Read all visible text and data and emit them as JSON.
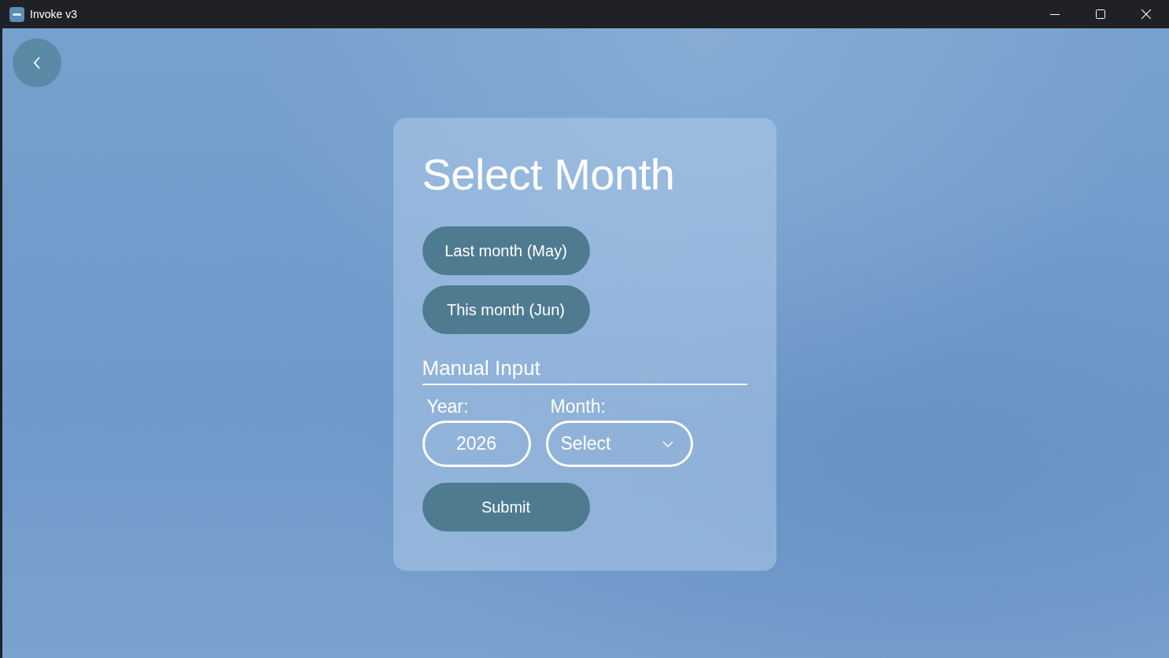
{
  "window": {
    "title": "Invoke v3"
  },
  "heading": "Select Month",
  "quick_buttons": [
    {
      "label": "Last month (May)"
    },
    {
      "label": "This month (Jun)"
    }
  ],
  "manual_input": {
    "title": "Manual Input",
    "year": {
      "label": "Year:",
      "value": "2026"
    },
    "month": {
      "label": "Month:",
      "value": "Select"
    }
  },
  "submit": {
    "label": "Submit"
  }
}
